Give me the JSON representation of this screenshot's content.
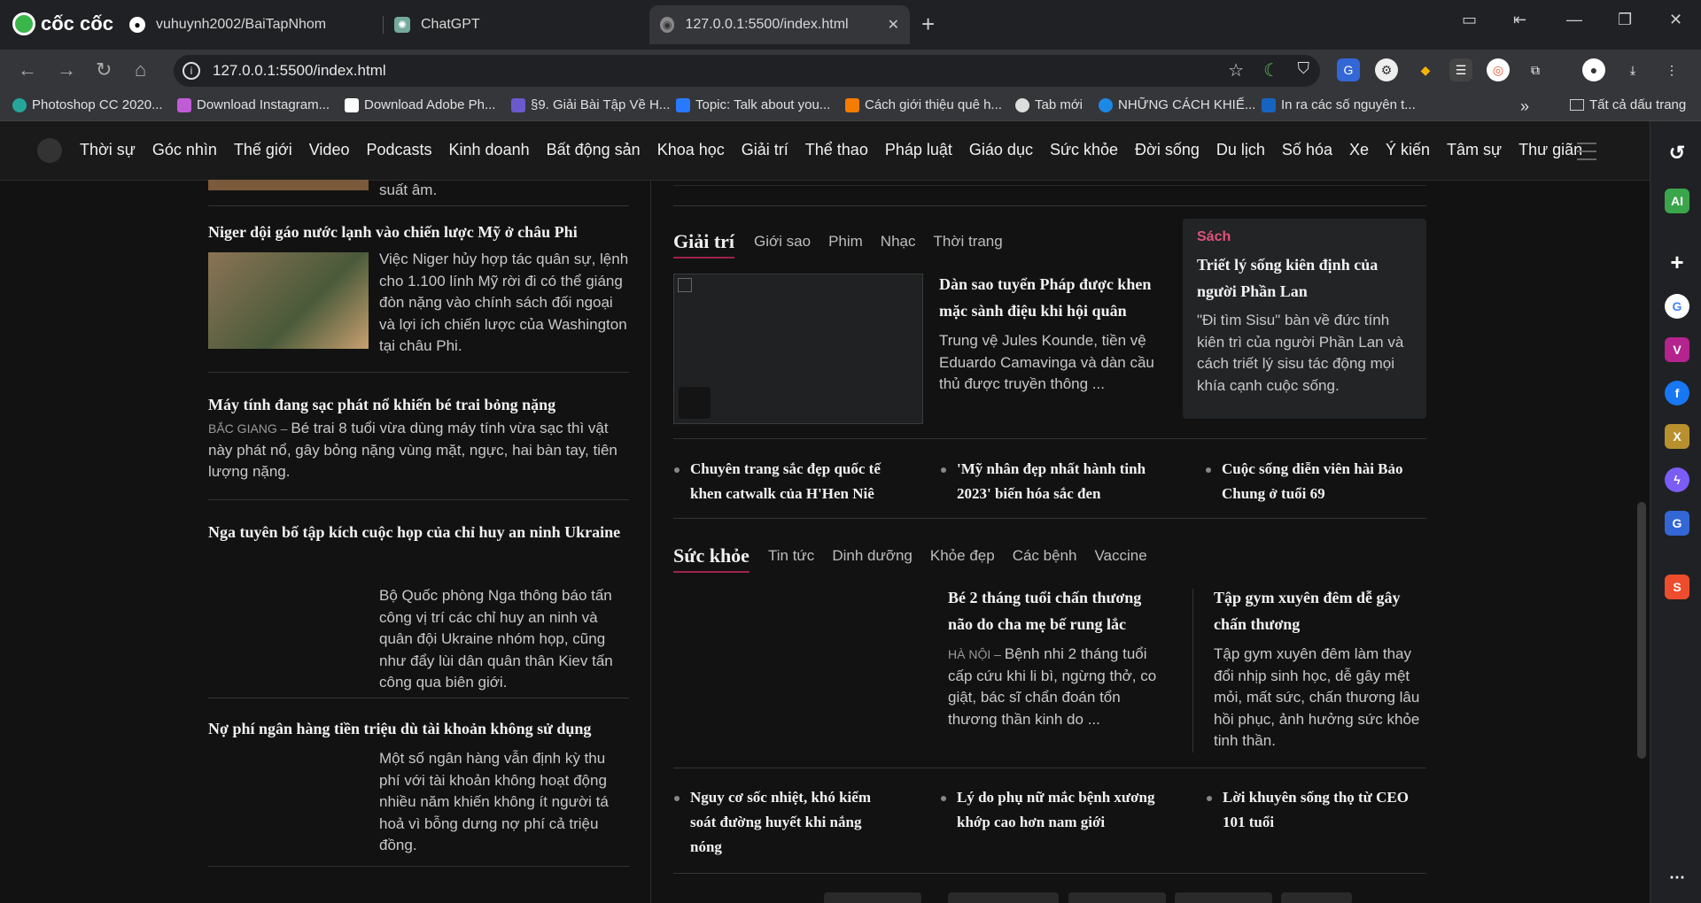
{
  "browser": {
    "brand": "cốc cốc",
    "tabs": [
      {
        "title": "vuhuynh2002/BaiTapNhom"
      },
      {
        "title": "ChatGPT"
      },
      {
        "title": "127.0.0.1:5500/index.html"
      }
    ],
    "url": "127.0.0.1:5500/index.html",
    "bookmarks": [
      "Photoshop CC 2020...",
      "Download Instagram...",
      "Download Adobe Ph...",
      "§9. Giải Bài Tập Về H...",
      "Topic: Talk about you...",
      "Cách giới thiệu quê h...",
      "Tab mới",
      "NHỮNG CÁCH KHIẾ...",
      "In ra các số nguyên t..."
    ],
    "all_bookmarks": "Tất cả dấu trang"
  },
  "nav": {
    "items": [
      "Thời sự",
      "Góc nhìn",
      "Thế giới",
      "Video",
      "Podcasts",
      "Kinh doanh",
      "Bất động sản",
      "Khoa học",
      "Giải trí",
      "Thể thao",
      "Pháp luật",
      "Giáo dục",
      "Sức khỏe",
      "Đời sống",
      "Du lịch",
      "Số hóa",
      "Xe",
      "Ý kiến",
      "Tâm sự",
      "Thư giãn"
    ]
  },
  "left": {
    "top_tail": "suất âm.",
    "articles": [
      {
        "title": "Niger dội gáo nước lạnh vào chiến lược Mỹ ở châu Phi",
        "summary": "Việc Niger hủy hợp tác quân sự, lệnh cho 1.100 lính Mỹ rời đi có thể giáng đòn nặng vào chính sách đối ngoại và lợi ích chiến lược của Washington tại châu Phi."
      },
      {
        "title": "Máy tính đang sạc phát nổ khiến bé trai bỏng nặng",
        "location": "BẮC GIANG",
        "summary": "Bé trai 8 tuổi vừa dùng máy tính vừa sạc thì vật này phát nổ, gây bỏng nặng vùng mặt, ngực, hai bàn tay, tiên lượng nặng."
      },
      {
        "title": "Nga tuyên bố tập kích cuộc họp của chỉ huy an ninh Ukraine",
        "summary": "Bộ Quốc phòng Nga thông báo tấn công vị trí các chỉ huy an ninh và quân đội Ukraine nhóm họp, cũng như đẩy lùi dân quân thân Kiev tấn công qua biên giới."
      },
      {
        "title": "Nợ phí ngân hàng tiền triệu dù tài khoản không sử dụng",
        "summary": "Một số ngân hàng vẫn định kỳ thu phí với tài khoản không hoạt động nhiều năm khiến không ít người tá hoả vì bỗng dưng nợ phí cả triệu đồng."
      }
    ]
  },
  "giaitri": {
    "title": "Giải trí",
    "subnav": [
      "Giới sao",
      "Phim",
      "Nhạc",
      "Thời trang"
    ],
    "main_title": "Dàn sao tuyển Pháp được khen mặc sành điệu khi hội quân",
    "main_summary": "Trung vệ Jules Kounde, tiền vệ Eduardo Camavinga và dàn cầu thủ được truyền thông ...",
    "box_label": "Sách",
    "box_title": "Triết lý sống kiên định của người Phần Lan",
    "box_summary": "\"Đi tìm Sisu\" bàn về đức tính kiên trì của người Phần Lan và cách triết lý sisu tác động mọi khía cạnh cuộc sống.",
    "bullets": [
      "Chuyên trang sắc đẹp quốc tế khen catwalk của H'Hen Niê",
      "'Mỹ nhân đẹp nhất hành tinh 2023' biến hóa sắc đen",
      "Cuộc sống diễn viên hài Bảo Chung ở tuổi 69"
    ]
  },
  "suckhoe": {
    "title": "Sức khỏe",
    "subnav": [
      "Tin tức",
      "Dinh dưỡng",
      "Khỏe đẹp",
      "Các bệnh",
      "Vaccine"
    ],
    "story1_title": "Bé 2 tháng tuổi chấn thương não do cha mẹ bế rung lắc",
    "story1_location": "HÀ NỘI",
    "story1_summary": "Bệnh nhi 2 tháng tuổi cấp cứu khi li bì, ngừng thở, co giật, bác sĩ chẩn đoán tổn thương thần kinh do ...",
    "story2_title": "Tập gym xuyên đêm dễ gây chấn thương",
    "story2_summary": "Tập gym xuyên đêm làm thay đổi nhịp sinh học, dễ gây mệt mỏi, mất sức, chấn thương lâu hồi phục, ảnh hưởng sức khỏe tinh thần.",
    "bullets": [
      "Nguy cơ sốc nhiệt, khó kiểm soát đường huyết khi nắng nóng",
      "Lý do phụ nữ mắc bệnh xương khớp cao hơn nam giới",
      "Lời khuyên sống thọ từ CEO 101 tuổi"
    ]
  },
  "colors": {
    "accent": "#9f224e",
    "box_label": "#e0527a"
  }
}
